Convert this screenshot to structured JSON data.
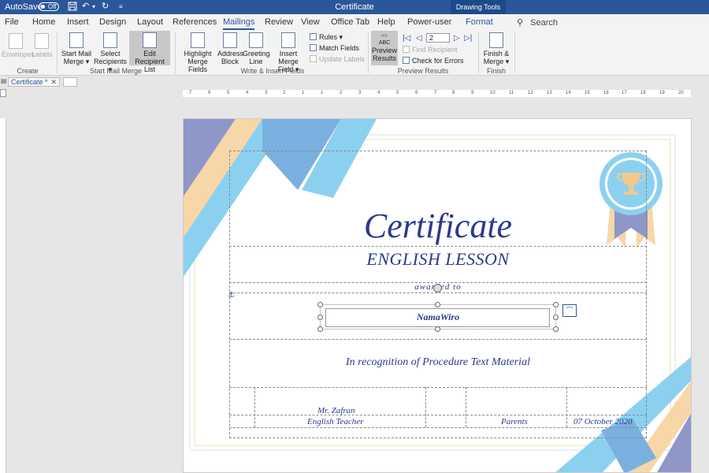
{
  "titlebar": {
    "autosave_label": "AutoSave",
    "autosave_state": "Off",
    "title": "Certificate",
    "drawing_tools": "Drawing Tools"
  },
  "menu": {
    "tabs": [
      "File",
      "Home",
      "Insert",
      "Design",
      "Layout",
      "References",
      "Mailings",
      "Review",
      "View",
      "Office Tab",
      "Help",
      "Power-user",
      "Format"
    ],
    "active": "Mailings",
    "search": "Search"
  },
  "ribbon": {
    "create": {
      "label": "Create",
      "envelopes": "Envelopes",
      "labels": "Labels"
    },
    "start_mail_merge": {
      "label": "Start Mail Merge",
      "start_line1": "Start Mail",
      "start_line2": "Merge",
      "select_line1": "Select",
      "select_line2": "Recipients",
      "edit_line1": "Edit",
      "edit_line2": "Recipient List"
    },
    "write_insert": {
      "label": "Write & Insert Fields",
      "highlight_line1": "Highlight",
      "highlight_line2": "Merge Fields",
      "address_line1": "Address",
      "address_line2": "Block",
      "greeting_line1": "Greeting",
      "greeting_line2": "Line",
      "insert_line1": "Insert Merge",
      "insert_line2": "Field",
      "rules": "Rules",
      "match_fields": "Match Fields",
      "update_labels": "Update Labels"
    },
    "preview": {
      "label": "Preview Results",
      "abc": "ABC",
      "preview_line1": "Preview",
      "preview_line2": "Results",
      "record": "2",
      "find_recipient": "Find Recipient",
      "check_errors": "Check for Errors"
    },
    "finish": {
      "label": "Finish",
      "finish_line1": "Finish &",
      "finish_line2": "Merge"
    }
  },
  "doc_tab": {
    "name": "Certificate *"
  },
  "ruler": {
    "ticks": [
      "7",
      "6",
      "5",
      "4",
      "3",
      "2",
      "1",
      "1",
      "2",
      "3",
      "4",
      "5",
      "6",
      "7",
      "8",
      "9",
      "10",
      "11",
      "12",
      "13",
      "14",
      "15",
      "16",
      "17",
      "18",
      "19",
      "20"
    ]
  },
  "certificate": {
    "title": "Certificate",
    "subtitle": "ENGLISH LESSON",
    "awarded": "awarded to",
    "name": "NamaWiro",
    "recognition": "In recognition of Procedure Text Material",
    "teacher_name": "Mr. Zafran",
    "teacher_role": "English Teacher",
    "parents": "Parents",
    "date": "07 October 2020"
  },
  "colors": {
    "title_blue": "#2b579a",
    "cert_text": "#2a3a8c",
    "ribbon_light_blue": "#8cd0f0",
    "ribbon_mid_blue": "#7ab0e0",
    "ribbon_purple": "#8f96c8",
    "peach": "#f7d6a8"
  },
  "icons": [
    "undo-icon",
    "redo-icon",
    "save-icon",
    "trophy-icon",
    "rosette-icon",
    "search-icon"
  ]
}
